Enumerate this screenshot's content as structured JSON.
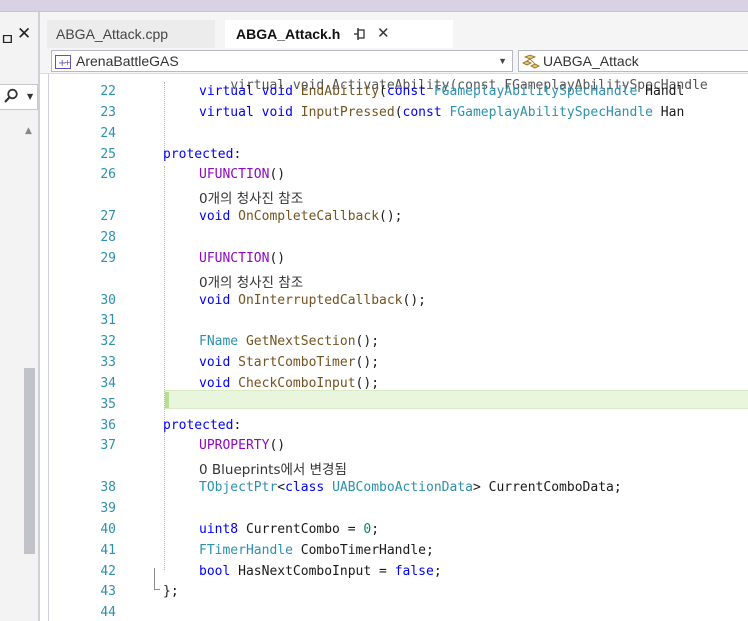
{
  "side_panel": {
    "title": "ㅁ",
    "close": "✕",
    "search_icon": "search-icon",
    "dropdown": "▼",
    "scroll_up": "▲"
  },
  "tabs": [
    {
      "label": "ABGA_Attack.cpp"
    },
    {
      "label": "ABGA_Attack.h",
      "pin": "⊣",
      "close": "✕"
    }
  ],
  "nav": {
    "project": "ArenaBattleGAS",
    "symbol": "UABGA_Attack",
    "arrow": "▼"
  },
  "editor": {
    "top_partial": "virtual void ActivateAbility(const FGameplayAbilitySpecHandle",
    "lines": [
      {
        "n": "22",
        "tokens": [
          [
            "kw",
            "virtual"
          ],
          [
            "p",
            " "
          ],
          [
            "kw",
            "void"
          ],
          [
            "p",
            " "
          ],
          [
            "fn",
            "EndAbility"
          ],
          [
            "p",
            "("
          ],
          [
            "kw",
            "const"
          ],
          [
            "p",
            " "
          ],
          [
            "tp",
            "FGameplayAbilitySpecHandle"
          ],
          [
            "p",
            " Handl"
          ]
        ]
      },
      {
        "n": "23",
        "tokens": [
          [
            "kw",
            "virtual"
          ],
          [
            "p",
            " "
          ],
          [
            "kw",
            "void"
          ],
          [
            "p",
            " "
          ],
          [
            "fn",
            "InputPressed"
          ],
          [
            "p",
            "("
          ],
          [
            "kw",
            "const"
          ],
          [
            "p",
            " "
          ],
          [
            "tp",
            "FGameplayAbilitySpecHandle"
          ],
          [
            "p",
            " Han"
          ]
        ]
      },
      {
        "n": "24",
        "tokens": []
      },
      {
        "n": "25",
        "tokens": [
          [
            "kw",
            "protected"
          ],
          [
            "p",
            ":"
          ]
        ],
        "outdent": true
      },
      {
        "n": "26",
        "tokens": [
          [
            "mc",
            "UFUNCTION"
          ],
          [
            "p",
            "()"
          ]
        ]
      },
      {
        "lens": "0개의 청사진 참조"
      },
      {
        "n": "27",
        "tokens": [
          [
            "kw",
            "void"
          ],
          [
            "p",
            " "
          ],
          [
            "fn",
            "OnCompleteCallback"
          ],
          [
            "p",
            "();"
          ]
        ]
      },
      {
        "n": "28",
        "tokens": []
      },
      {
        "n": "29",
        "tokens": [
          [
            "mc",
            "UFUNCTION"
          ],
          [
            "p",
            "()"
          ]
        ]
      },
      {
        "lens": "0개의 청사진 참조"
      },
      {
        "n": "30",
        "tokens": [
          [
            "kw",
            "void"
          ],
          [
            "p",
            " "
          ],
          [
            "fn",
            "OnInterruptedCallback"
          ],
          [
            "p",
            "();"
          ]
        ]
      },
      {
        "n": "31",
        "tokens": []
      },
      {
        "n": "32",
        "tokens": [
          [
            "tp",
            "FName"
          ],
          [
            "p",
            " "
          ],
          [
            "fn",
            "GetNextSection"
          ],
          [
            "p",
            "();"
          ]
        ]
      },
      {
        "n": "33",
        "tokens": [
          [
            "kw",
            "void"
          ],
          [
            "p",
            " "
          ],
          [
            "fn",
            "StartComboTimer"
          ],
          [
            "p",
            "();"
          ]
        ]
      },
      {
        "n": "34",
        "tokens": [
          [
            "kw",
            "void"
          ],
          [
            "p",
            " "
          ],
          [
            "fn",
            "CheckComboInput"
          ],
          [
            "p",
            "();"
          ]
        ]
      },
      {
        "n": "35",
        "tokens": [],
        "current": true
      },
      {
        "n": "36",
        "tokens": [
          [
            "kw",
            "protected"
          ],
          [
            "p",
            ":"
          ]
        ],
        "outdent": true
      },
      {
        "n": "37",
        "tokens": [
          [
            "mc",
            "UPROPERTY"
          ],
          [
            "p",
            "()"
          ]
        ]
      },
      {
        "lens": "0 Blueprints에서 변경됨"
      },
      {
        "n": "38",
        "tokens": [
          [
            "tp",
            "TObjectPtr"
          ],
          [
            "p",
            "<"
          ],
          [
            "kw",
            "class"
          ],
          [
            "p",
            " "
          ],
          [
            "tp",
            "UABComboActionData"
          ],
          [
            "p",
            "> CurrentComboData;"
          ]
        ]
      },
      {
        "n": "39",
        "tokens": []
      },
      {
        "n": "40",
        "tokens": [
          [
            "kw",
            "uint8"
          ],
          [
            "p",
            " CurrentCombo = "
          ],
          [
            "nm",
            "0"
          ],
          [
            "p",
            ";"
          ]
        ]
      },
      {
        "n": "41",
        "tokens": [
          [
            "tp",
            "FTimerHandle"
          ],
          [
            "p",
            " ComboTimerHandle;"
          ]
        ]
      },
      {
        "n": "42",
        "tokens": [
          [
            "kw",
            "bool"
          ],
          [
            "p",
            " HasNextComboInput = "
          ],
          [
            "kw",
            "false"
          ],
          [
            "p",
            ";"
          ]
        ]
      },
      {
        "n": "43",
        "tokens": [
          [
            "p",
            "};"
          ]
        ],
        "outdent": true
      },
      {
        "n": "44",
        "tokens": []
      }
    ]
  }
}
